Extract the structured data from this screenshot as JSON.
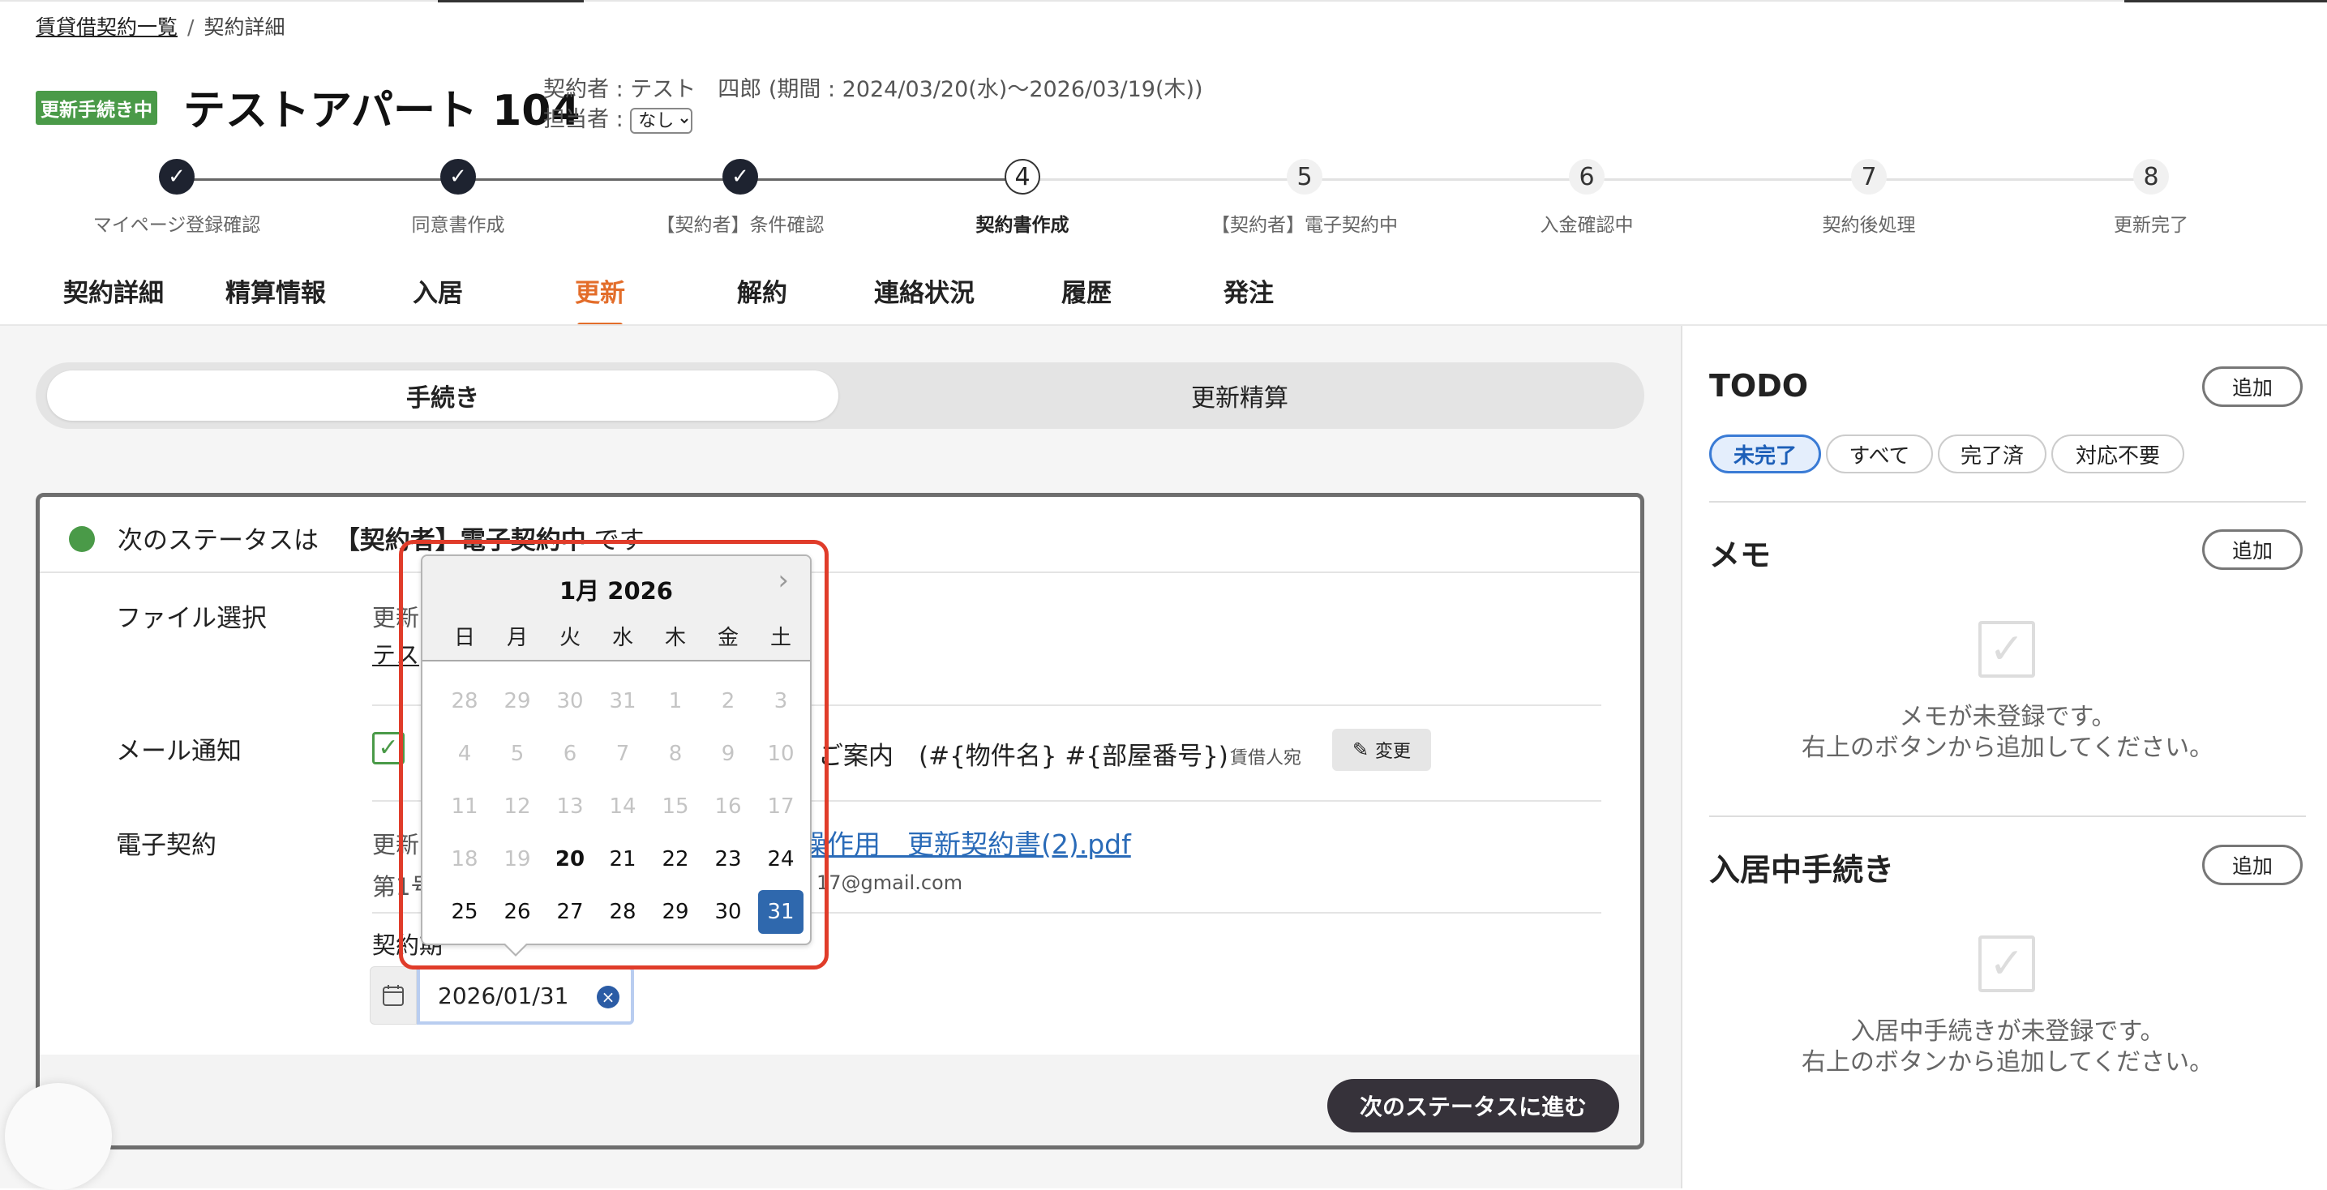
{
  "breadcrumb": {
    "list": "賃貸借契約一覧",
    "sep": "/",
    "current": "契約詳細"
  },
  "header": {
    "status_badge": "更新手続き中",
    "title": "テストアパート 104",
    "contractor": "契約者 : テスト　四郎 (期間 : 2024/03/20(水)〜2026/03/19(木))",
    "assignee_label": "担当者 :",
    "assignee_value": "なし"
  },
  "stepper": [
    {
      "label": "マイページ登録確認",
      "state": "done"
    },
    {
      "label": "同意書作成",
      "state": "done"
    },
    {
      "label": "【契約者】条件確認",
      "state": "done"
    },
    {
      "num": "4",
      "label": "契約書作成",
      "state": "current"
    },
    {
      "num": "5",
      "label": "【契約者】電子契約中",
      "state": "todo"
    },
    {
      "num": "6",
      "label": "入金確認中",
      "state": "todo"
    },
    {
      "num": "7",
      "label": "契約後処理",
      "state": "todo"
    },
    {
      "num": "8",
      "label": "更新完了",
      "state": "todo"
    }
  ],
  "tabs": [
    "契約詳細",
    "精算情報",
    "入居",
    "更新",
    "解約",
    "連絡状況",
    "履歴",
    "発注"
  ],
  "active_tab": "更新",
  "segment": {
    "left": "手続き",
    "right": "更新精算"
  },
  "card": {
    "next_prefix": "次のステータスは",
    "next_status": "【契約者】電子契約中",
    "next_suffix": "です",
    "file_label": "ファイル選択",
    "file_text1": "更新",
    "file_link1": "テス",
    "mail_label": "メール通知",
    "mail_subject": "ご案内　(#{物件名} #{部屋番号})",
    "mail_to": "賃借人宛",
    "change_button": "変更",
    "econtract_label": "電子契約",
    "econtract_prefix": "更新",
    "econtract_link": "操作用　更新契約書(2).pdf",
    "signer_prefix": "第1号",
    "signer_email": "17@gmail.com",
    "contract_date_label": "契約期",
    "date_value": "2026/01/31",
    "next_button": "次のステータスに進む"
  },
  "datepicker": {
    "title": "1月 2026",
    "weekdays": [
      "日",
      "月",
      "火",
      "水",
      "木",
      "金",
      "土"
    ],
    "weeks": [
      [
        "28",
        "29",
        "30",
        "31",
        "1",
        "2",
        "3"
      ],
      [
        "4",
        "5",
        "6",
        "7",
        "8",
        "9",
        "10"
      ],
      [
        "11",
        "12",
        "13",
        "14",
        "15",
        "16",
        "17"
      ],
      [
        "18",
        "19",
        "20",
        "21",
        "22",
        "23",
        "24"
      ],
      [
        "25",
        "26",
        "27",
        "28",
        "29",
        "30",
        "31"
      ]
    ],
    "selected": "31",
    "today": "20",
    "first_enabled": "20"
  },
  "todo": {
    "title": "TODO",
    "add": "追加",
    "filters": [
      "未完了",
      "すべて",
      "完了済",
      "対応不要"
    ],
    "active_filter": "未完了"
  },
  "memo": {
    "title": "メモ",
    "add": "追加",
    "empty1": "メモが未登録です。",
    "empty2": "右上のボタンから追加してください。"
  },
  "occupancy": {
    "title": "入居中手続き",
    "add": "追加",
    "empty1": "入居中手続きが未登録です。",
    "empty2": "右上のボタンから追加してください。"
  },
  "colors": {
    "accent": "#e36d2a",
    "status_green": "#4a9a48",
    "primary_blue": "#2f68ad",
    "highlight_red": "#e03c2a"
  }
}
